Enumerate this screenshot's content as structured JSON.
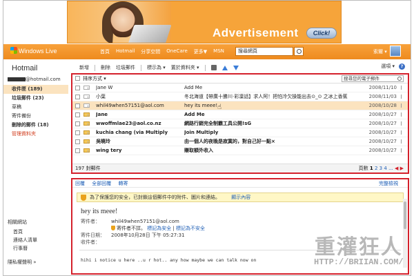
{
  "ad": {
    "text": "Advertisement",
    "button": "Click!"
  },
  "topbar": {
    "logo": "Windows Live",
    "nav": [
      "首頁",
      "Hotmail",
      "分享空間",
      "OneCare",
      "更多▼",
      "MSN"
    ],
    "search_placeholder": "搜尋網頁",
    "user": "索爾 ▾"
  },
  "sidebar": {
    "brand": "Hotmail",
    "email_suffix": "@hotmail.com",
    "folders": [
      {
        "label": "收件匣 (189)",
        "state": "selected"
      },
      {
        "label": "垃圾郵件 (23)",
        "state": "bold"
      },
      {
        "label": "草稿",
        "state": "normal"
      },
      {
        "label": "寄件備份",
        "state": "normal"
      },
      {
        "label": "刪除的郵件 (18)",
        "state": "bold"
      },
      {
        "label": "管理資料夾",
        "state": "link"
      }
    ],
    "related_title": "相關網站",
    "related": [
      "首頁",
      "連絡人清單",
      "行事曆"
    ],
    "privacy": "隱私權聲明 »"
  },
  "toolbar": {
    "items": [
      "新增",
      "刪除",
      "垃圾郵件",
      "標示為 ▾",
      "置於資料夾 ▾"
    ],
    "options": "選項 ▾",
    "help": "?"
  },
  "list": {
    "sort_label": "排序方式 ▾",
    "search_placeholder": "搜尋您的電子郵件",
    "rows": [
      {
        "from": "Jane W",
        "subject": "Add Me",
        "date": "2008/11/10",
        "unread": false,
        "icon": "plain"
      },
      {
        "from": "小葉",
        "subject": "冬北海道【帶廣十勝川·彩凜話】求人阿！把怕冷欠操能出去⊙_⊙ 之冰上香蕉",
        "date": "2008/11/03",
        "unread": false,
        "icon": "plain"
      },
      {
        "from": "whil49when57151@aol.com",
        "subject": "hey its meee!",
        "date": "2008/10/28",
        "unread": false,
        "icon": "plain",
        "hover": true
      },
      {
        "from": "Jane",
        "subject": "Add Me",
        "date": "2008/10/27",
        "unread": true,
        "icon": "yellow"
      },
      {
        "from": "wwoffmlae23@aol.co.nz",
        "subject": "網路行銷完全制霸工具公開!sG",
        "date": "2008/10/27",
        "unread": true,
        "icon": "yellow"
      },
      {
        "from": "kuchia chang (via Multiply",
        "subject": "Join Multiply",
        "date": "2008/10/27",
        "unread": true,
        "icon": "yellow"
      },
      {
        "from": "吳曉玲",
        "subject": "由一個人的夜晚是寂寞的，對自己好一點×",
        "date": "2008/10/27",
        "unread": true,
        "icon": "yellow"
      },
      {
        "from": "wing tery",
        "subject": "賺取額外收入",
        "date": "2008/10/27",
        "unread": true,
        "icon": "yellow"
      }
    ],
    "count": "197 封郵件",
    "pages_label": "頁數",
    "pages": [
      "1",
      "2",
      "3",
      "4",
      "..."
    ],
    "page_nav": "◀ ▶"
  },
  "reader": {
    "actions": [
      "回覆",
      "全部回覆",
      "轉寄"
    ],
    "full_view": "完整檢視",
    "notice": "為了保護您的安全，已封鎖這個郵件中的附件、圖片和連結。",
    "notice_link": "顯示內容",
    "subject": "hey its meee!",
    "from_label": "寄件者：",
    "from_value": "whil49when57151@aol.com",
    "trust_text": "寄件者不詳。",
    "mark_safe": "標記為安全",
    "mark_unsafe": "標記為不安全",
    "date_label": "寄件日期：",
    "date_value": "2008年10月28日 下午 05:27:31",
    "to_label": "收件者：",
    "body": "hihi i notice u here ..u r hot.. any how maybe we can talk now on"
  },
  "watermark": {
    "title": "重灌狂人",
    "url": "HTTP://BRIIAN.COM/"
  }
}
